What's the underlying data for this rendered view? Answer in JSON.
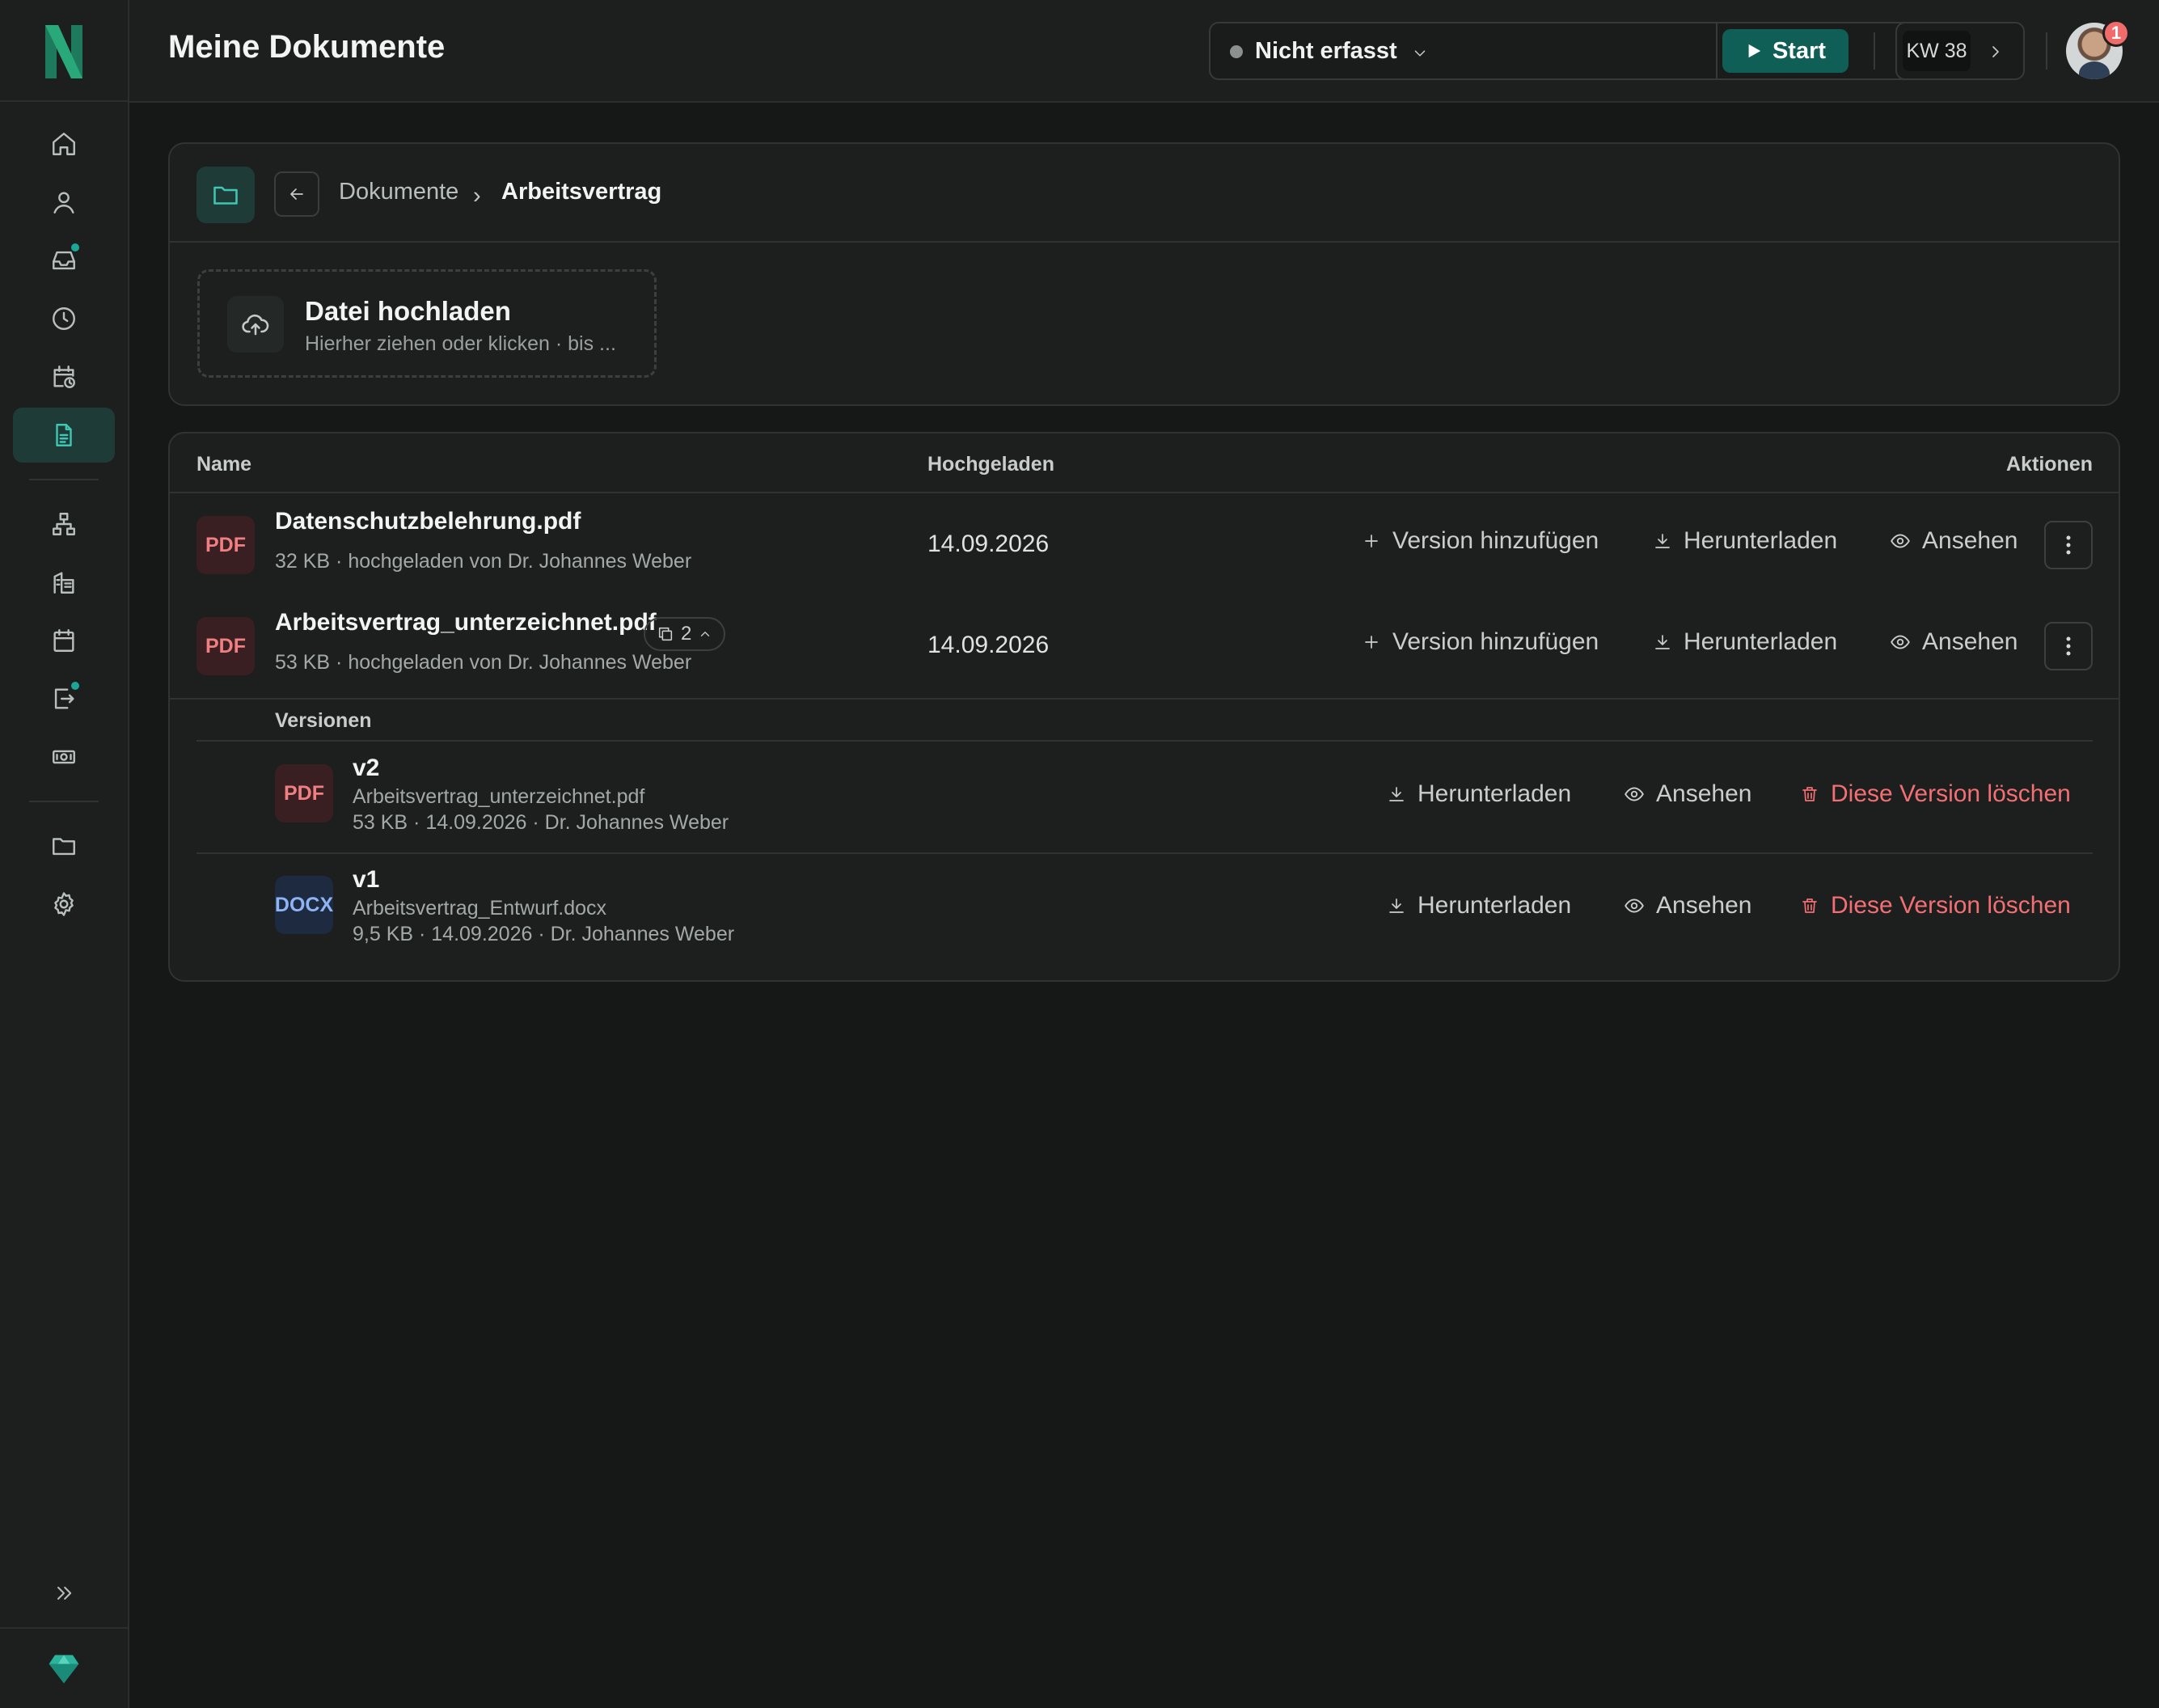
{
  "header": {
    "title": "Meine Dokumente",
    "timer_status": "Nicht erfasst",
    "start_label": "Start",
    "week_label": "KW 38",
    "notification_count": "1"
  },
  "sidebar": {
    "items": [
      {
        "name": "home",
        "icon": "home-icon"
      },
      {
        "name": "profile",
        "icon": "user-icon"
      },
      {
        "name": "inbox",
        "icon": "inbox-icon",
        "dot": true
      },
      {
        "name": "time",
        "icon": "clock-icon"
      },
      {
        "name": "calendar-time",
        "icon": "calendar-clock-icon"
      },
      {
        "name": "documents",
        "icon": "document-icon",
        "active": true
      },
      {
        "name": "org-chart",
        "icon": "org-chart-icon"
      },
      {
        "name": "company",
        "icon": "building-icon"
      },
      {
        "name": "calendar",
        "icon": "calendar-icon"
      },
      {
        "name": "transfer",
        "icon": "transfer-icon",
        "dot": true
      },
      {
        "name": "payroll",
        "icon": "money-icon"
      },
      {
        "name": "files",
        "icon": "folder-icon"
      },
      {
        "name": "settings",
        "icon": "gear-icon"
      }
    ]
  },
  "breadcrumb": {
    "root": "Dokumente",
    "separator": "›",
    "current": "Arbeitsvertrag"
  },
  "upload": {
    "title": "Datei hochladen",
    "subtitle": "Hierher ziehen oder klicken · bis ..."
  },
  "table": {
    "headers": {
      "name": "Name",
      "uploaded": "Hochgeladen",
      "actions": "Aktionen"
    },
    "rows": [
      {
        "type": "PDF",
        "name": "Datenschutzbelehrung.pdf",
        "meta": "32 KB · hochgeladen von Dr. Johannes Weber",
        "date": "14.09.2026"
      },
      {
        "type": "PDF",
        "name": "Arbeitsvertrag_unterzeichnet.pdf",
        "meta": "53 KB · hochgeladen von Dr. Johannes Weber",
        "date": "14.09.2026",
        "version_count": "2"
      }
    ],
    "actions": {
      "add_version": "Version hinzufügen",
      "download": "Herunterladen",
      "view": "Ansehen",
      "delete_version": "Diese Version löschen"
    },
    "versions_label": "Versionen",
    "versions": [
      {
        "type": "PDF",
        "label": "v2",
        "file": "Arbeitsvertrag_unterzeichnet.pdf",
        "meta": "53 KB · 14.09.2026 · Dr. Johannes Weber"
      },
      {
        "type": "DOCX",
        "label": "v1",
        "file": "Arbeitsvertrag_Entwurf.docx",
        "meta": "9,5 KB · 14.09.2026 · Dr. Johannes Weber"
      }
    ]
  },
  "colors": {
    "accent": "#3fc7b4",
    "start_button": "#0f5f56",
    "danger": "#f36f73",
    "pdf_badge": "#f07f82",
    "docx_badge": "#8fb4f5"
  }
}
